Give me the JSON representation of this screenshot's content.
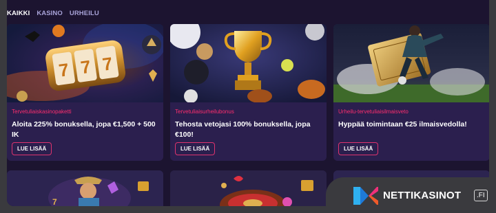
{
  "tabs": [
    {
      "label": "KAIKKI",
      "active": true
    },
    {
      "label": "KASINO",
      "active": false
    },
    {
      "label": "URHEILU",
      "active": false
    }
  ],
  "cards": [
    {
      "tag": "Tervetuliaiskasinopaketti",
      "title": "Aloita 225% bonuksella, jopa €1,500 + 500 IK",
      "button": "LUE LISÄÄ",
      "image": "slot-machine-777-image"
    },
    {
      "tag": "Tervetuliaisurheilubonus",
      "title": "Tehosta vetojasi 100% bonuksella, jopa €100!",
      "button": "LUE LISÄÄ",
      "image": "trophy-sports-balls-image"
    },
    {
      "tag": "Urheilu-tervetuliaisilmaisveto",
      "title": "Hyppää toimintaan €25 ilmaisvedolla!",
      "button": "LUE LISÄÄ",
      "image": "soccer-player-ticket-image"
    }
  ],
  "brand": {
    "name": "NETTIKASINOT",
    "tld": ".FI"
  },
  "colors": {
    "background": "#1c1430",
    "card": "#2b1f4e",
    "accent": "#ff2e6e",
    "tab_inactive": "#a8a3d8",
    "frame": "#3a3a3e"
  }
}
